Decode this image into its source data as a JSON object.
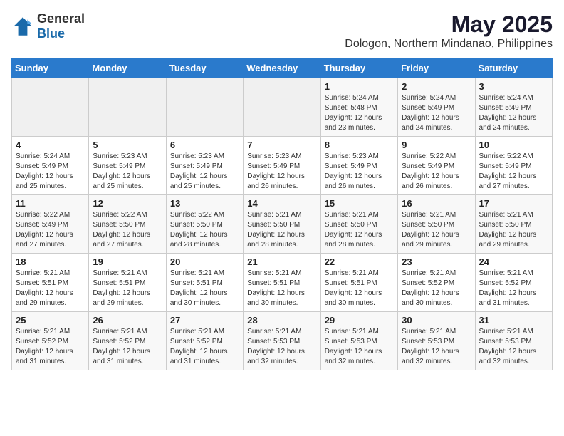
{
  "header": {
    "logo_general": "General",
    "logo_blue": "Blue",
    "title": "May 2025",
    "subtitle": "Dologon, Northern Mindanao, Philippines"
  },
  "weekdays": [
    "Sunday",
    "Monday",
    "Tuesday",
    "Wednesday",
    "Thursday",
    "Friday",
    "Saturday"
  ],
  "weeks": [
    [
      {
        "day": "",
        "info": ""
      },
      {
        "day": "",
        "info": ""
      },
      {
        "day": "",
        "info": ""
      },
      {
        "day": "",
        "info": ""
      },
      {
        "day": "1",
        "info": "Sunrise: 5:24 AM\nSunset: 5:48 PM\nDaylight: 12 hours\nand 23 minutes."
      },
      {
        "day": "2",
        "info": "Sunrise: 5:24 AM\nSunset: 5:49 PM\nDaylight: 12 hours\nand 24 minutes."
      },
      {
        "day": "3",
        "info": "Sunrise: 5:24 AM\nSunset: 5:49 PM\nDaylight: 12 hours\nand 24 minutes."
      }
    ],
    [
      {
        "day": "4",
        "info": "Sunrise: 5:24 AM\nSunset: 5:49 PM\nDaylight: 12 hours\nand 25 minutes."
      },
      {
        "day": "5",
        "info": "Sunrise: 5:23 AM\nSunset: 5:49 PM\nDaylight: 12 hours\nand 25 minutes."
      },
      {
        "day": "6",
        "info": "Sunrise: 5:23 AM\nSunset: 5:49 PM\nDaylight: 12 hours\nand 25 minutes."
      },
      {
        "day": "7",
        "info": "Sunrise: 5:23 AM\nSunset: 5:49 PM\nDaylight: 12 hours\nand 26 minutes."
      },
      {
        "day": "8",
        "info": "Sunrise: 5:23 AM\nSunset: 5:49 PM\nDaylight: 12 hours\nand 26 minutes."
      },
      {
        "day": "9",
        "info": "Sunrise: 5:22 AM\nSunset: 5:49 PM\nDaylight: 12 hours\nand 26 minutes."
      },
      {
        "day": "10",
        "info": "Sunrise: 5:22 AM\nSunset: 5:49 PM\nDaylight: 12 hours\nand 27 minutes."
      }
    ],
    [
      {
        "day": "11",
        "info": "Sunrise: 5:22 AM\nSunset: 5:49 PM\nDaylight: 12 hours\nand 27 minutes."
      },
      {
        "day": "12",
        "info": "Sunrise: 5:22 AM\nSunset: 5:50 PM\nDaylight: 12 hours\nand 27 minutes."
      },
      {
        "day": "13",
        "info": "Sunrise: 5:22 AM\nSunset: 5:50 PM\nDaylight: 12 hours\nand 28 minutes."
      },
      {
        "day": "14",
        "info": "Sunrise: 5:21 AM\nSunset: 5:50 PM\nDaylight: 12 hours\nand 28 minutes."
      },
      {
        "day": "15",
        "info": "Sunrise: 5:21 AM\nSunset: 5:50 PM\nDaylight: 12 hours\nand 28 minutes."
      },
      {
        "day": "16",
        "info": "Sunrise: 5:21 AM\nSunset: 5:50 PM\nDaylight: 12 hours\nand 29 minutes."
      },
      {
        "day": "17",
        "info": "Sunrise: 5:21 AM\nSunset: 5:50 PM\nDaylight: 12 hours\nand 29 minutes."
      }
    ],
    [
      {
        "day": "18",
        "info": "Sunrise: 5:21 AM\nSunset: 5:51 PM\nDaylight: 12 hours\nand 29 minutes."
      },
      {
        "day": "19",
        "info": "Sunrise: 5:21 AM\nSunset: 5:51 PM\nDaylight: 12 hours\nand 29 minutes."
      },
      {
        "day": "20",
        "info": "Sunrise: 5:21 AM\nSunset: 5:51 PM\nDaylight: 12 hours\nand 30 minutes."
      },
      {
        "day": "21",
        "info": "Sunrise: 5:21 AM\nSunset: 5:51 PM\nDaylight: 12 hours\nand 30 minutes."
      },
      {
        "day": "22",
        "info": "Sunrise: 5:21 AM\nSunset: 5:51 PM\nDaylight: 12 hours\nand 30 minutes."
      },
      {
        "day": "23",
        "info": "Sunrise: 5:21 AM\nSunset: 5:52 PM\nDaylight: 12 hours\nand 30 minutes."
      },
      {
        "day": "24",
        "info": "Sunrise: 5:21 AM\nSunset: 5:52 PM\nDaylight: 12 hours\nand 31 minutes."
      }
    ],
    [
      {
        "day": "25",
        "info": "Sunrise: 5:21 AM\nSunset: 5:52 PM\nDaylight: 12 hours\nand 31 minutes."
      },
      {
        "day": "26",
        "info": "Sunrise: 5:21 AM\nSunset: 5:52 PM\nDaylight: 12 hours\nand 31 minutes."
      },
      {
        "day": "27",
        "info": "Sunrise: 5:21 AM\nSunset: 5:52 PM\nDaylight: 12 hours\nand 31 minutes."
      },
      {
        "day": "28",
        "info": "Sunrise: 5:21 AM\nSunset: 5:53 PM\nDaylight: 12 hours\nand 32 minutes."
      },
      {
        "day": "29",
        "info": "Sunrise: 5:21 AM\nSunset: 5:53 PM\nDaylight: 12 hours\nand 32 minutes."
      },
      {
        "day": "30",
        "info": "Sunrise: 5:21 AM\nSunset: 5:53 PM\nDaylight: 12 hours\nand 32 minutes."
      },
      {
        "day": "31",
        "info": "Sunrise: 5:21 AM\nSunset: 5:53 PM\nDaylight: 12 hours\nand 32 minutes."
      }
    ]
  ]
}
